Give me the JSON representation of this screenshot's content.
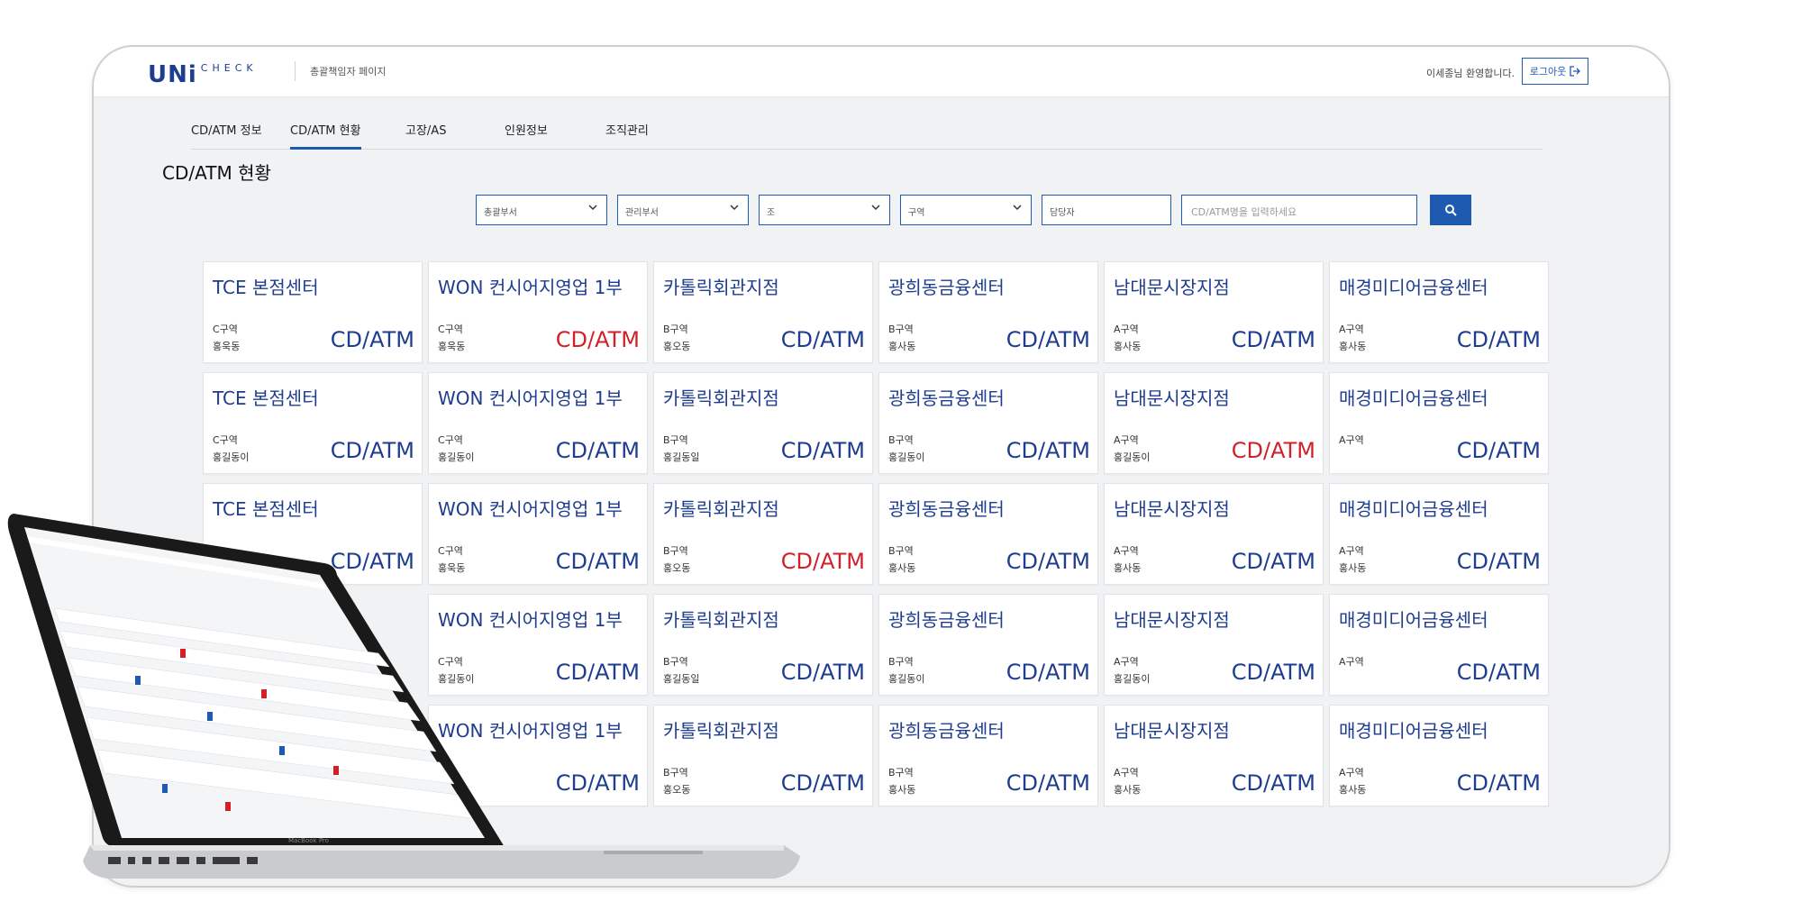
{
  "header": {
    "logo_main": "UNi",
    "logo_sub": "CHECK",
    "page_subtitle": "총괄책임자 페이지",
    "welcome": "이세종님 환영합니다.",
    "logout_label": "로그아웃"
  },
  "nav": {
    "tabs": [
      {
        "label": "CD/ATM 정보",
        "active": false
      },
      {
        "label": "CD/ATM 현황",
        "active": true
      },
      {
        "label": "고장/AS",
        "active": false
      },
      {
        "label": "인원정보",
        "active": false
      },
      {
        "label": "조직관리",
        "active": false
      }
    ]
  },
  "main": {
    "title": "CD/ATM 현황"
  },
  "filters": {
    "selects": [
      "총괄부서",
      "관리부서",
      "조",
      "구역"
    ],
    "manager_placeholder": "담당자",
    "search_placeholder": "CD/ATM명을 입력하세요"
  },
  "colors": {
    "accent": "#1e5bb0",
    "card_title": "#1e3d8f",
    "alert": "#d0202a"
  },
  "cards": [
    {
      "name": "TCE 본점센터",
      "zone": "C구역",
      "manager": "홍욱동",
      "device": "CD/ATM",
      "alert": false
    },
    {
      "name": "WON 컨시어지영업 1부",
      "zone": "C구역",
      "manager": "홍욱동",
      "device": "CD/ATM",
      "alert": true
    },
    {
      "name": "카톨릭회관지점",
      "zone": "B구역",
      "manager": "홍오동",
      "device": "CD/ATM",
      "alert": false
    },
    {
      "name": "광희동금융센터",
      "zone": "B구역",
      "manager": "홍사동",
      "device": "CD/ATM",
      "alert": false
    },
    {
      "name": "남대문시장지점",
      "zone": "A구역",
      "manager": "홍사동",
      "device": "CD/ATM",
      "alert": false
    },
    {
      "name": "매경미디어금융센터",
      "zone": "A구역",
      "manager": "홍사동",
      "device": "CD/ATM",
      "alert": false
    },
    {
      "name": "TCE 본점센터",
      "zone": "C구역",
      "manager": "홍길동이",
      "device": "CD/ATM",
      "alert": false
    },
    {
      "name": "WON 컨시어지영업 1부",
      "zone": "C구역",
      "manager": "홍길동이",
      "device": "CD/ATM",
      "alert": false
    },
    {
      "name": "카톨릭회관지점",
      "zone": "B구역",
      "manager": "홍길동일",
      "device": "CD/ATM",
      "alert": false
    },
    {
      "name": "광희동금융센터",
      "zone": "B구역",
      "manager": "홍길동이",
      "device": "CD/ATM",
      "alert": false
    },
    {
      "name": "남대문시장지점",
      "zone": "A구역",
      "manager": "홍길동이",
      "device": "CD/ATM",
      "alert": true
    },
    {
      "name": "매경미디어금융센터",
      "zone": "A구역",
      "manager": "",
      "device": "CD/ATM",
      "alert": false
    },
    {
      "name": "TCE 본점센터",
      "zone": "",
      "manager": "",
      "device": "CD/ATM",
      "alert": false
    },
    {
      "name": "WON 컨시어지영업 1부",
      "zone": "C구역",
      "manager": "홍욱동",
      "device": "CD/ATM",
      "alert": false
    },
    {
      "name": "카톨릭회관지점",
      "zone": "B구역",
      "manager": "홍오동",
      "device": "CD/ATM",
      "alert": true
    },
    {
      "name": "광희동금융센터",
      "zone": "B구역",
      "manager": "홍사동",
      "device": "CD/ATM",
      "alert": false
    },
    {
      "name": "남대문시장지점",
      "zone": "A구역",
      "manager": "홍사동",
      "device": "CD/ATM",
      "alert": false
    },
    {
      "name": "매경미디어금융센터",
      "zone": "A구역",
      "manager": "홍사동",
      "device": "CD/ATM",
      "alert": false
    },
    {
      "name": "",
      "zone": "",
      "manager": "",
      "device": "",
      "alert": false
    },
    {
      "name": "WON 컨시어지영업 1부",
      "zone": "C구역",
      "manager": "홍길동이",
      "device": "CD/ATM",
      "alert": false
    },
    {
      "name": "카톨릭회관지점",
      "zone": "B구역",
      "manager": "홍길동일",
      "device": "CD/ATM",
      "alert": false
    },
    {
      "name": "광희동금융센터",
      "zone": "B구역",
      "manager": "홍길동이",
      "device": "CD/ATM",
      "alert": false
    },
    {
      "name": "남대문시장지점",
      "zone": "A구역",
      "manager": "홍길동이",
      "device": "CD/ATM",
      "alert": false
    },
    {
      "name": "매경미디어금융센터",
      "zone": "A구역",
      "manager": "",
      "device": "CD/ATM",
      "alert": false
    },
    {
      "name": "",
      "zone": "",
      "manager": "",
      "device": "",
      "alert": false
    },
    {
      "name": "WON 컨시어지영업 1부",
      "zone": "",
      "manager": "",
      "device": "CD/ATM",
      "alert": false
    },
    {
      "name": "카톨릭회관지점",
      "zone": "B구역",
      "manager": "홍오동",
      "device": "CD/ATM",
      "alert": false
    },
    {
      "name": "광희동금융센터",
      "zone": "B구역",
      "manager": "홍사동",
      "device": "CD/ATM",
      "alert": false
    },
    {
      "name": "남대문시장지점",
      "zone": "A구역",
      "manager": "홍사동",
      "device": "CD/ATM",
      "alert": false
    },
    {
      "name": "매경미디어금융센터",
      "zone": "A구역",
      "manager": "홍사동",
      "device": "CD/ATM",
      "alert": false
    }
  ],
  "laptop": {
    "brand_label": "MacBook Pro"
  }
}
